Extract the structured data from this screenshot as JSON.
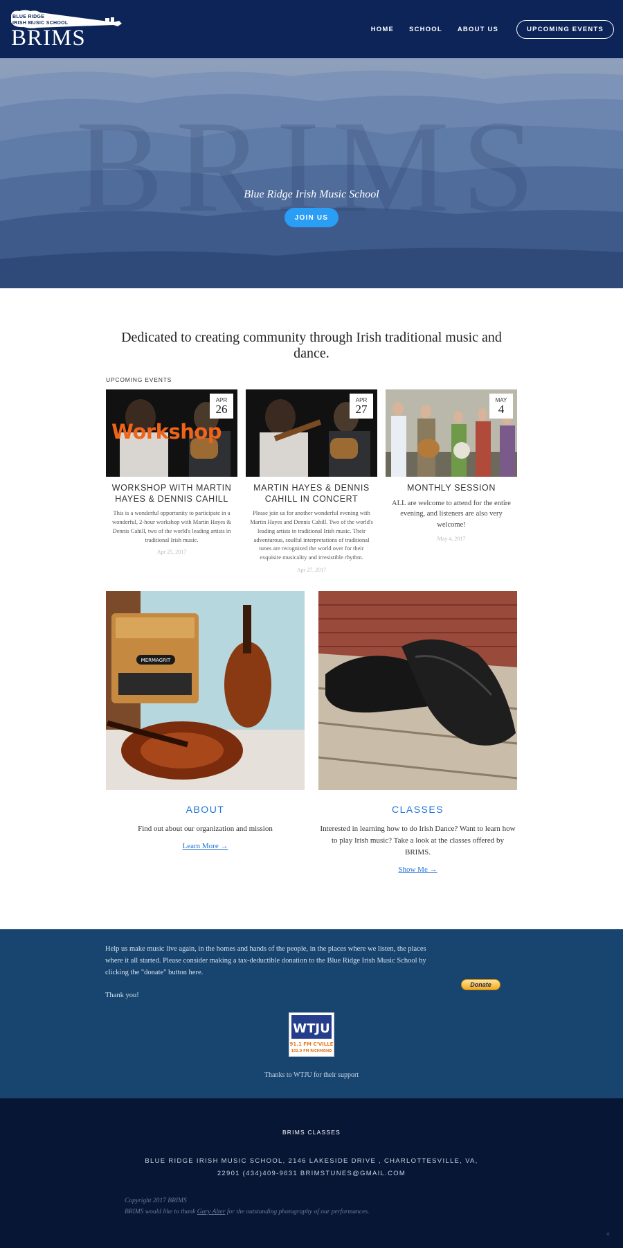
{
  "header": {
    "logo_tagline_1": "BLUE RIDGE",
    "logo_tagline_2": "IRISH MUSIC SCHOOL",
    "logo_brand": "BRIMS",
    "nav": [
      "HOME",
      "SCHOOL",
      "ABOUT US"
    ],
    "cta": "UPCOMING EVENTS"
  },
  "hero": {
    "ghost_text": "BRIMS",
    "tagline": "Blue Ridge Irish Music School",
    "button": "JOIN US"
  },
  "main": {
    "mission": "Dedicated to creating community through Irish traditional music and dance.",
    "events_label": "UPCOMING EVENTS",
    "events": [
      {
        "month": "APR",
        "day": "26",
        "title": "WORKSHOP WITH MARTIN HAYES & DENNIS CAHILL",
        "overlay": "Workshop",
        "description": "This is a wonderful opportunity to participate in a wonderful, 2-hour workshop with Martin Hayes & Dennis Cahill, two of the world's leading artists in traditional Irish music.",
        "posted": "Apr 25, 2017"
      },
      {
        "month": "APR",
        "day": "27",
        "title": "MARTIN HAYES & DENNIS CAHILL IN CONCERT",
        "description": "Please join us for another wonderful evening with Martin Hayes and Dennis Cahill. Two of the world's leading artists in traditional Irish music. Their adventurous, soulful interpretations of traditional tunes are recognized the world over for their exquisite musicality and irresistible rhythm.",
        "posted": "Apr 27, 2017"
      },
      {
        "month": "MAY",
        "day": "4",
        "title": "MONTHLY SESSION",
        "description": "ALL are welcome to attend for the entire evening, and listeners are also very welcome!",
        "posted": "May 4, 2017"
      }
    ],
    "features": [
      {
        "heading": "ABOUT",
        "text": "Find out about our organization and mission",
        "link": "Learn More →",
        "badge": "MERMAGRIT"
      },
      {
        "heading": "CLASSES",
        "text": "Interested in learning how to do Irish Dance? Want to learn how to play Irish music? Take a look at the classes offered by BRIMS.",
        "link": "Show Me →"
      }
    ]
  },
  "donate": {
    "paragraph": "Help us make music live again, in the homes and hands of the people, in the places where we listen, the places where it all started. Please consider making a tax-deductible donation to the Blue Ridge Irish Music School by clicking the \"donate\" button here.",
    "thanks_line": "Thank you!",
    "button": "Donate",
    "sponsor_logo": "WTJU",
    "sponsor_line1": "91.1 FM C'VILLE",
    "sponsor_line2": "102.9 FM RICHMOND",
    "sponsor_thanks": "Thanks to WTJU for their support"
  },
  "footer": {
    "heading": "BRIMS CLASSES",
    "address_line1": "BLUE RIDGE IRISH MUSIC SCHOOL, 2146 LAKESIDE DRIVE , CHARLOTTESVILLE, VA,",
    "address_line2": "22901   (434)409-9631   BRIMSTUNES@GMAIL.COM",
    "copyright": "Copyright 2017 BRIMS",
    "credit_prefix": "BRIMS would like to thank ",
    "credit_link": "Gary Alter",
    "credit_suffix": " for the outstanding photography of our performances."
  },
  "colors": {
    "header_bg": "#0d2458",
    "accent": "#2a9df4",
    "link": "#1e73d8",
    "donate_bg": "#17456f",
    "footer_bg": "#081636"
  }
}
